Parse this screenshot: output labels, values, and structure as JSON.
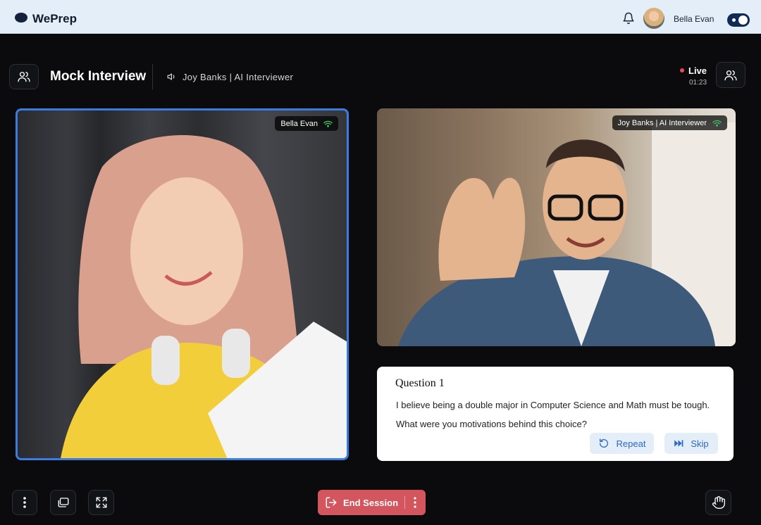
{
  "app": {
    "name": "WePrep"
  },
  "user": {
    "name": "Bella Evan"
  },
  "session": {
    "title": "Mock Interview",
    "interviewer": "Joy Banks | AI Interviewer",
    "status": "Live",
    "elapsed": "01:23"
  },
  "videos": {
    "left": {
      "name": "Bella Evan"
    },
    "right": {
      "name": "Joy Banks | AI Interviewer"
    }
  },
  "question": {
    "title": "Question 1",
    "line1": "I believe being a double major in Computer Science and Math must be tough.",
    "line2": "What were you motivations behind this choice?",
    "repeat_label": "Repeat",
    "skip_label": "Skip"
  },
  "toolbar": {
    "end_label": "End Session"
  },
  "colors": {
    "accent": "#3c7be0",
    "danger": "#d3555e",
    "nav_bg": "#e4eef8",
    "live": "#e54b5a"
  },
  "icons": [
    "bell-icon",
    "people-icon",
    "speaker-icon",
    "wifi-icon",
    "repeat-icon",
    "skip-icon",
    "more-icon",
    "window-icon",
    "fullscreen-icon",
    "exit-icon",
    "hand-icon"
  ]
}
